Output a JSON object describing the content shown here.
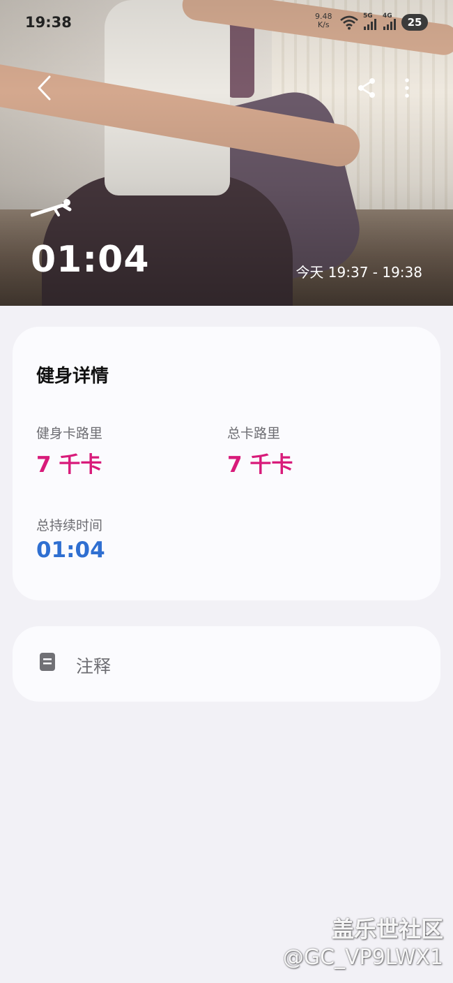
{
  "status_bar": {
    "time": "19:38",
    "net_speed_value": "9.48",
    "net_speed_unit": "K/s",
    "sim1_label": "5G",
    "sim2_label": "4G",
    "battery": "25"
  },
  "hero": {
    "workout_icon": "plank-exercise-icon",
    "duration": "01:04",
    "time_range": "今天 19:37 - 19:38"
  },
  "details": {
    "title": "健身详情",
    "workout_calories_label": "健身卡路里",
    "workout_calories_value": "7 千卡",
    "total_calories_label": "总卡路里",
    "total_calories_value": "7 千卡",
    "total_duration_label": "总持续时间",
    "total_duration_value": "01:04"
  },
  "notes": {
    "icon": "note-icon",
    "label": "注释"
  },
  "watermark": {
    "site": "盖乐世社区",
    "user": "@GC_VP9LWX1"
  },
  "colors": {
    "calorie_value": "#d81b7a",
    "duration_value": "#2f6fd1",
    "background": "#f2f1f6",
    "card": "#fbfbfe"
  }
}
